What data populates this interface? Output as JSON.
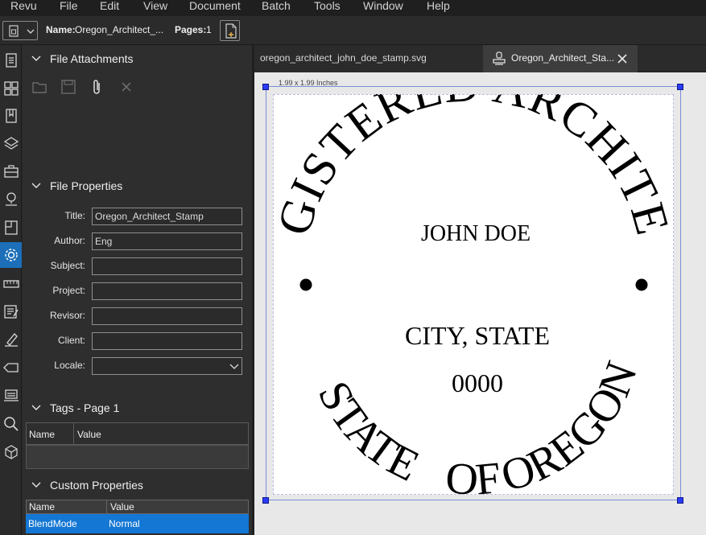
{
  "menu": [
    "Revu",
    "File",
    "Edit",
    "View",
    "Document",
    "Batch",
    "Tools",
    "Window",
    "Help"
  ],
  "toolbar": {
    "name_label": "Name:",
    "name_value": "Oregon_Architect_...",
    "pages_label": "Pages:",
    "pages_value": "1"
  },
  "icons": [
    "thumbnails-icon",
    "grid-icon",
    "bookmarks-icon",
    "layers-icon",
    "toolbox-icon",
    "places-icon",
    "file-access-icon",
    "properties-icon",
    "measurements-icon",
    "markups-icon",
    "signatures-icon",
    "tag-icon",
    "studio-icon",
    "search-icon",
    "3d-icon"
  ],
  "panel": {
    "attachments_title": "File Attachments",
    "file_properties_title": "File Properties",
    "properties": [
      {
        "label": "Title:",
        "value": "Oregon_Architect_Stamp"
      },
      {
        "label": "Author:",
        "value": "Eng"
      },
      {
        "label": "Subject:",
        "value": ""
      },
      {
        "label": "Project:",
        "value": ""
      },
      {
        "label": "Revisor:",
        "value": ""
      },
      {
        "label": "Client:",
        "value": ""
      },
      {
        "label": "Locale:",
        "value": ""
      }
    ],
    "tags_title": "Tags - Page 1",
    "tags_columns": [
      "Name",
      "Value"
    ],
    "custom_title": "Custom Properties",
    "custom_columns": [
      "Name",
      "Value"
    ],
    "custom_rows": [
      {
        "name": "BlendMode",
        "value": "Normal"
      }
    ]
  },
  "tabs": [
    {
      "label": "oregon_architect_john_doe_stamp.svg"
    },
    {
      "label": "Oregon_Architect_Sta..."
    }
  ],
  "canvas": {
    "size_label": "1.99 x 1.99 Inches"
  },
  "stamp": {
    "top_arc": "REGISTERED ARCHITECT",
    "name": "JOHN DOE",
    "city": "CITY, STATE",
    "number": "0000",
    "bottom_left": "STATE",
    "bottom_mid": "OF",
    "bottom_right": "OREGON"
  },
  "colors": {
    "accent": "#1c6fb8",
    "selected_row": "#1477d4",
    "handle": "#2a3bff"
  }
}
